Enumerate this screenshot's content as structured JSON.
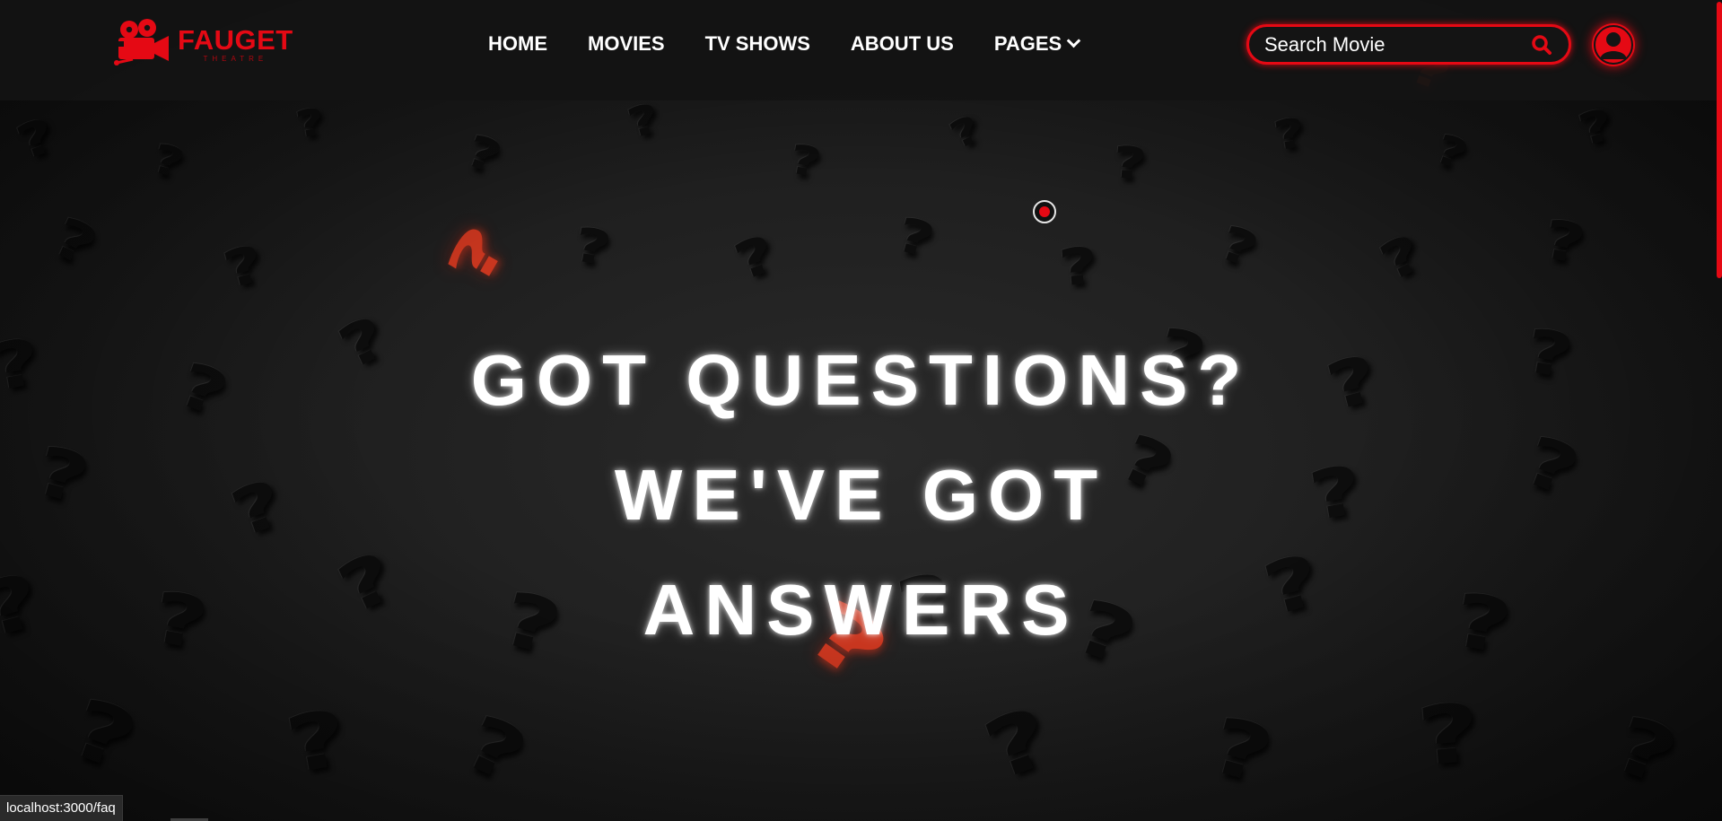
{
  "brand": {
    "name": "FAUGET",
    "subtitle": "THEATRE",
    "accent_color": "#e50914",
    "logo_icon": "film-camera-icon"
  },
  "nav": {
    "items": [
      {
        "label": "HOME"
      },
      {
        "label": "MOVIES"
      },
      {
        "label": "TV SHOWS"
      },
      {
        "label": "ABOUT US"
      },
      {
        "label": "PAGES",
        "icon": "chevron-down-icon"
      }
    ]
  },
  "search": {
    "placeholder": "Search Movie",
    "icon": "search-icon"
  },
  "user": {
    "icon": "user-avatar-icon"
  },
  "hero": {
    "lines": [
      "GOT QUESTIONS?",
      "WE'VE GOT",
      "ANSWERS"
    ],
    "background": "scattered question marks"
  },
  "status_bar": {
    "url": "localhost:3000/faq"
  }
}
